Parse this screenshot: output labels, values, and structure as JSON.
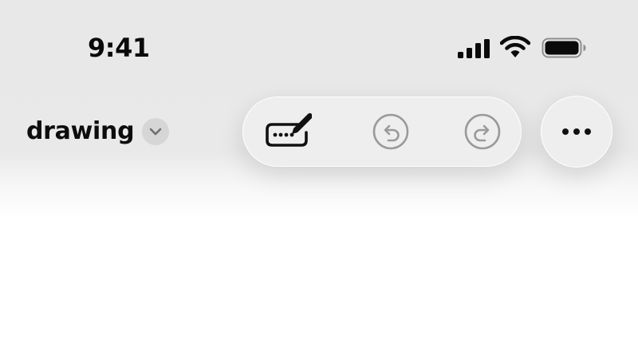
{
  "status_bar": {
    "time": "9:41",
    "icons": [
      "cellular-signal-icon",
      "wifi-icon",
      "battery-icon"
    ],
    "battery_level": 1.0
  },
  "header": {
    "title": "drawing",
    "title_menu_icon": "chevron-down-icon"
  },
  "toolbar": {
    "buttons": [
      {
        "icon": "markup-pen-icon",
        "enabled": true
      },
      {
        "icon": "undo-icon",
        "enabled": false
      },
      {
        "icon": "redo-icon",
        "enabled": false
      }
    ],
    "more_icon": "ellipsis-icon"
  },
  "colors": {
    "background_top": "#e8e8e8",
    "canvas": "#ffffff",
    "control_fill": "#eeeeee",
    "icon_active": "#111111",
    "icon_disabled": "#9a9a9a",
    "chevron_bg": "#d6d6d6",
    "chevron_fg": "#6e6e6e"
  }
}
